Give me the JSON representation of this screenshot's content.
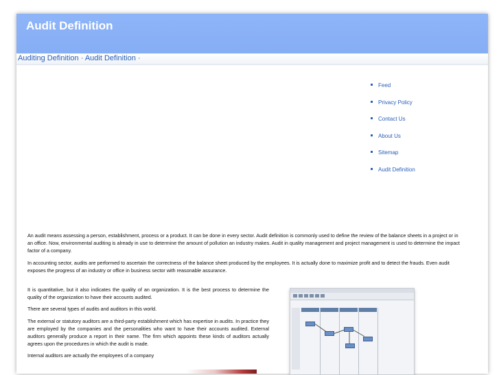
{
  "header": {
    "title": "Audit Definition"
  },
  "breadcrumb": {
    "text": "Auditing Definition · Audit Definition ·"
  },
  "nav": {
    "items": [
      "Feed",
      "Privacy Policy",
      "Contact Us",
      "About Us",
      "Sitemap",
      "Audit Definition"
    ]
  },
  "article": {
    "p1": "An audit means assessing a person, establishment, process or a product. It can be done in every sector. Audit definition is commonly used to define the review of the balance sheets in a project or in an office. Now, environmental auditing is already in use to determine the amount of pollution an industry makes. Audit in quality management and project management is used to determine the impact factor of a company.",
    "p2": "In accounting sector, audits are performed to ascertain the correctness of the balance sheet produced by the employees. It is actually done to maximize profit and to detect the frauds. Even audit exposes the progress of an industry or office in business sector with reasonable assurance.",
    "p3": "It is quantitative, but it also indicates the quality of an organization. It is the best process to determine the quality of the organization to have their accounts audited.",
    "p4": "There are several types of audits and auditors in this world.",
    "p5": "The external or statutory auditors are a third-party establishment which has expertise in audits. In practice they are employed by the companies and the personalities who want to have their accounts audited. External auditors generally produce a report in their name. The firm which appoints these kinds of auditors actually agrees upon the procedures in which the audit is made.",
    "p6": "Internal auditors are actually the employees of a company"
  },
  "colors": {
    "header": "#8eb4f8",
    "link": "#2a5fb8"
  }
}
